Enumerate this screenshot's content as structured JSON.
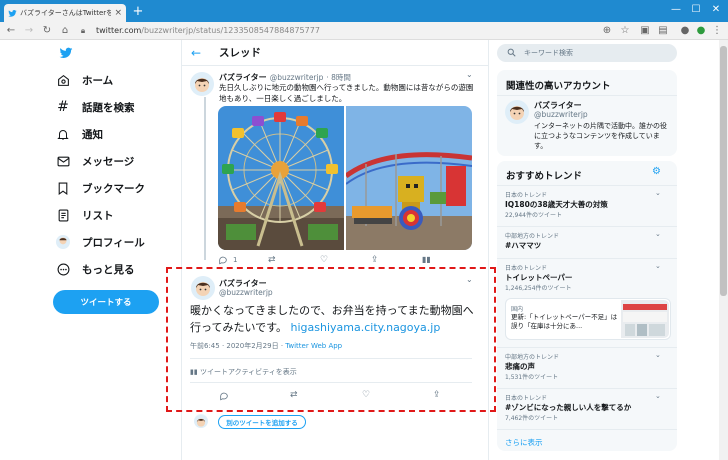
{
  "browser": {
    "tab_title": "バズライターさんはTwitterを使っています",
    "tab_close": "×",
    "new_tab": "+",
    "url_host": "twitter.com",
    "url_path": "/buzzwriterjp/status/1233508547884875777",
    "win_min": "—",
    "win_max": "☐",
    "win_close": "✕"
  },
  "sidebar": {
    "items": [
      {
        "label": "ホーム",
        "icon": "home-icon"
      },
      {
        "label": "話題を検索",
        "icon": "hashtag-icon"
      },
      {
        "label": "通知",
        "icon": "bell-icon"
      },
      {
        "label": "メッセージ",
        "icon": "mail-icon"
      },
      {
        "label": "ブックマーク",
        "icon": "bookmark-icon"
      },
      {
        "label": "リスト",
        "icon": "list-icon"
      },
      {
        "label": "プロフィール",
        "icon": "avatar"
      },
      {
        "label": "もっと見る",
        "icon": "more-icon"
      }
    ],
    "tweet_button": "ツイートする"
  },
  "thread": {
    "title": "スレッド",
    "parent": {
      "name": "バズライター",
      "handle": "@buzzwriterjp",
      "time": "· 8時間",
      "text": "先日久しぶりに地元の動物園へ行ってきました。動物園には昔ながらの遊園地もあり、一日楽しく過ごしました。",
      "reply_count": "1"
    },
    "main": {
      "name": "バズライター",
      "handle": "@buzzwriterjp",
      "text": "暖かくなってきましたので、お弁当を持ってまた動物園へ行ってみたいです。",
      "link": "higashiyama.city.nagoya.jp",
      "timestamp": "午前6:45 · 2020年2月29日",
      "source": "Twitter Web App",
      "activity": "ツイートアクティビティを表示"
    },
    "add_tweet": "別のツイートを追加する"
  },
  "right": {
    "search_placeholder": "キーワード検索",
    "related_title": "関連性の高いアカウント",
    "account": {
      "name": "バズライター",
      "handle": "@buzzwriterjp",
      "bio": "インターネットの片隅で活動中。誰かの役に立つようなコンテンツを作成しています。"
    },
    "trends_title": "おすすめトレンド",
    "trends": [
      {
        "context": "日本のトレンド",
        "name": "IQ180の38歳天才大善の対策",
        "count": "22,944件のツイート"
      },
      {
        "context": "中部地方のトレンド",
        "name": "#ハママツ",
        "count": ""
      },
      {
        "context": "日本のトレンド",
        "name": "トイレットペーパー",
        "count": "1,246,254件のツイート"
      },
      {
        "context": "中部地方のトレンド",
        "name": "悲痛の声",
        "count": "1,531件のツイート"
      },
      {
        "context": "日本のトレンド",
        "name": "#ゾンビになった親しい人を撃てるか",
        "count": "7,462件のツイート"
      }
    ],
    "news": {
      "tag": "国内",
      "text": "更新:「トイレットペーパー不足」は誤り「在庫は十分にあ..."
    },
    "show_more": "さらに表示"
  }
}
